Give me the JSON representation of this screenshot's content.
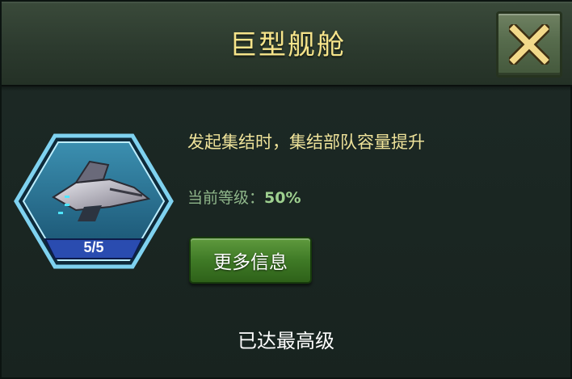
{
  "header": {
    "title": "巨型舰舱"
  },
  "close_button": {
    "icon": "close-icon"
  },
  "skill": {
    "level_badge": "5/5",
    "description": "发起集结时，集结部队容量提升",
    "current_level_label": "当前等级：",
    "current_level_value": "50%",
    "more_info_label": "更多信息",
    "max_level_text": "已达最高级"
  },
  "colors": {
    "title": "#f6e48a",
    "description": "#efe39a",
    "level_value": "#9ed08f",
    "button_green": "#3f7a26",
    "badge_blue": "#2a4cb0"
  }
}
